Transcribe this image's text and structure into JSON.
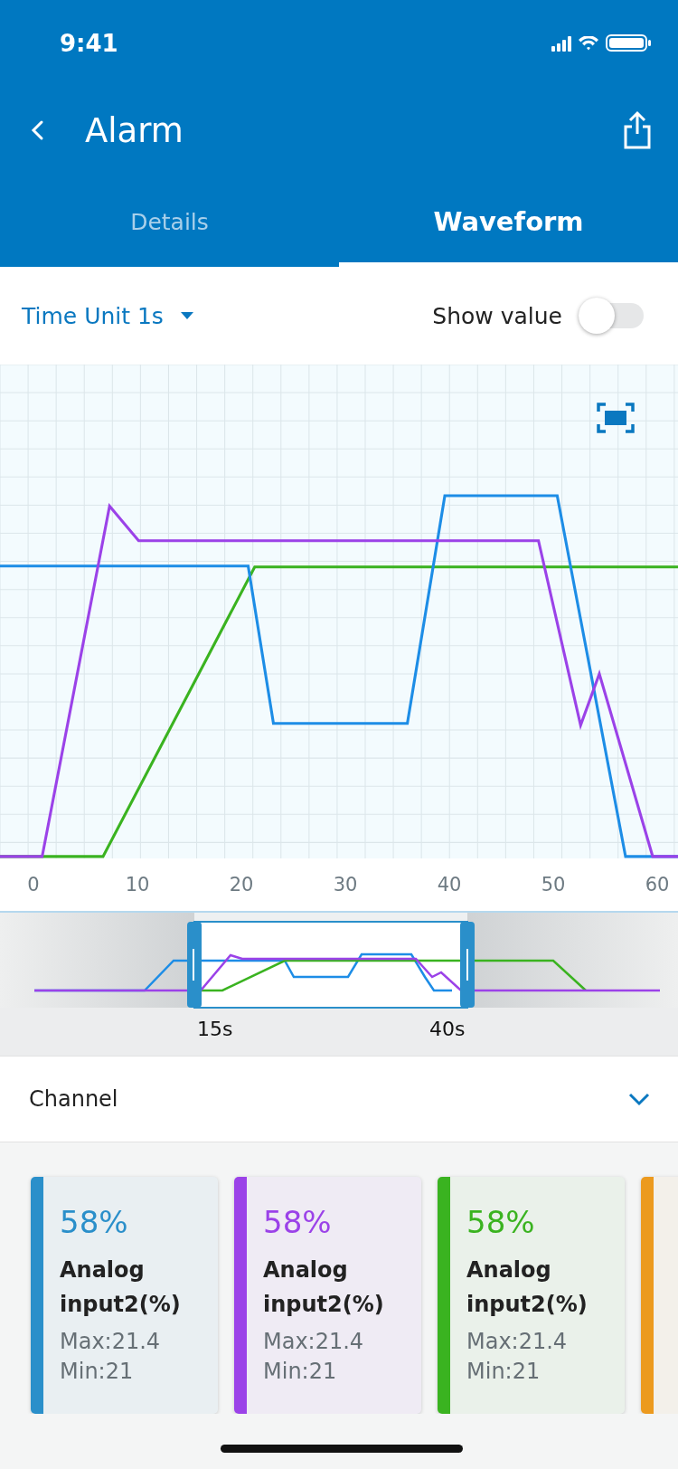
{
  "status_bar": {
    "time": "9:41"
  },
  "header": {
    "title": "Alarm"
  },
  "tabs": [
    {
      "label": "Details",
      "selected": false
    },
    {
      "label": "Waveform",
      "selected": true
    }
  ],
  "toolbar": {
    "time_unit": "Time Unit 1s",
    "show_value": {
      "label": "Show value",
      "on": false
    }
  },
  "chart": {
    "x_tick_labels": [
      "0",
      "10",
      "20",
      "30",
      "40",
      "50",
      "60"
    ]
  },
  "overview": {
    "range_start": "15s",
    "range_end": "40s"
  },
  "channel_selector": {
    "label": "Channel",
    "expanded": false
  },
  "channels": [
    {
      "value": "58%",
      "name": "Analog input2(%)",
      "max": "Max:21.4",
      "min": "Min:21",
      "color": "#2a8fca"
    },
    {
      "value": "58%",
      "name": "Analog input2(%)",
      "max": "Max:21.4",
      "min": "Min:21",
      "color": "#9b42e8"
    },
    {
      "value": "58%",
      "name": "Analog input2(%)",
      "max": "Max:21.4",
      "min": "Min:21",
      "color": "#3ab320"
    },
    {
      "color": "#ec9a1e"
    }
  ]
}
